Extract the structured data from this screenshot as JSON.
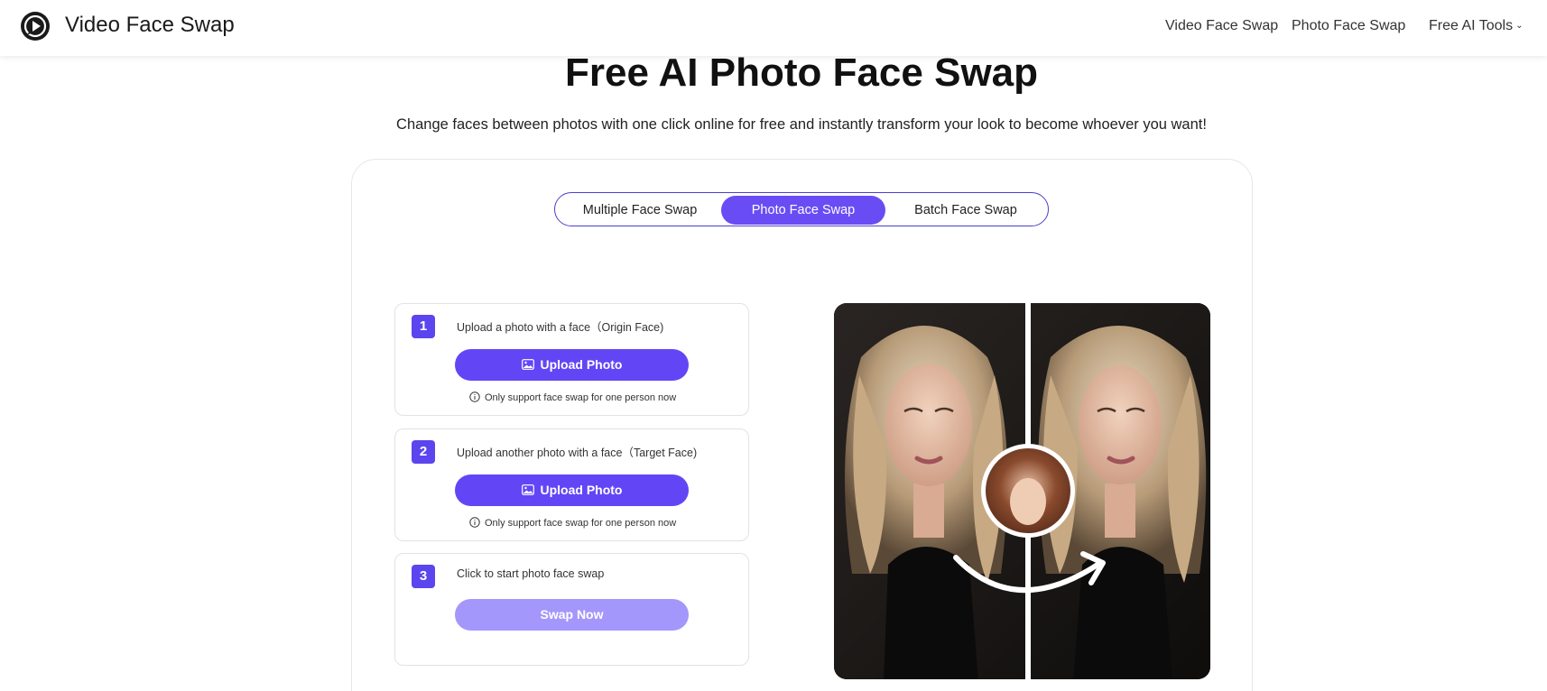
{
  "header": {
    "brand": "Video Face Swap",
    "nav": [
      {
        "label": "Video Face Swap"
      },
      {
        "label": "Photo Face Swap"
      },
      {
        "label": "Free AI Tools"
      }
    ]
  },
  "hero": {
    "title": "Free AI Photo Face Swap",
    "subtitle": "Change faces between photos with one click online for free and instantly transform your look to become whoever you want!"
  },
  "tabs": [
    {
      "label": "Multiple Face Swap",
      "active": false
    },
    {
      "label": "Photo Face Swap",
      "active": true
    },
    {
      "label": "Batch Face Swap",
      "active": false
    }
  ],
  "steps": [
    {
      "number": "1",
      "text": "Upload a photo with a face（Origin Face)",
      "button": "Upload Photo",
      "note": "Only support face swap for one person now"
    },
    {
      "number": "2",
      "text": "Upload another photo with a face（Target Face)",
      "button": "Upload Photo",
      "note": "Only support face swap for one person now"
    },
    {
      "number": "3",
      "text": "Click to start photo face swap",
      "button": "Swap Now",
      "button_disabled": true
    }
  ],
  "colors": {
    "accent": "#6246f5",
    "accent_disabled": "#a497fb",
    "tab_border": "#4b3fcf"
  },
  "icons": {
    "logo": "play-logo-icon",
    "upload": "image-icon",
    "info": "info-circle-icon",
    "dropdown": "chevron-down-icon"
  }
}
